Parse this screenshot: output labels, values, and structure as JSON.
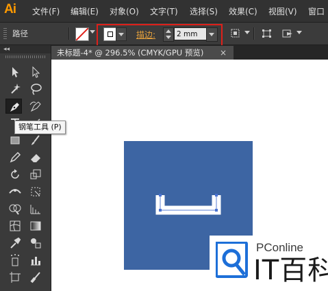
{
  "app": {
    "logo": "Ai"
  },
  "menu": {
    "items": [
      "文件(F)",
      "编辑(E)",
      "对象(O)",
      "文字(T)",
      "选择(S)",
      "效果(C)",
      "视图(V)",
      "窗口"
    ]
  },
  "control_bar": {
    "selection_label": "路径",
    "stroke_label": "描边:",
    "stroke_weight": "2 mm"
  },
  "document": {
    "tab_title": "未标题-4* @ 296.5% (CMYK/GPU 预览)",
    "close_glyph": "×"
  },
  "tooltip": {
    "text": "钢笔工具 (P)"
  },
  "toolbox": {
    "collapse_glyph": "◂◂"
  },
  "watermark": {
    "brand": "PConline",
    "wordmark": "IT百科"
  },
  "colors": {
    "accent": "#ff9a00",
    "highlight_border": "#e0201a",
    "shape_fill": "#3d65a3",
    "watermark_blue": "#1d6fd8",
    "stroke_label_color": "#e8a23c"
  }
}
